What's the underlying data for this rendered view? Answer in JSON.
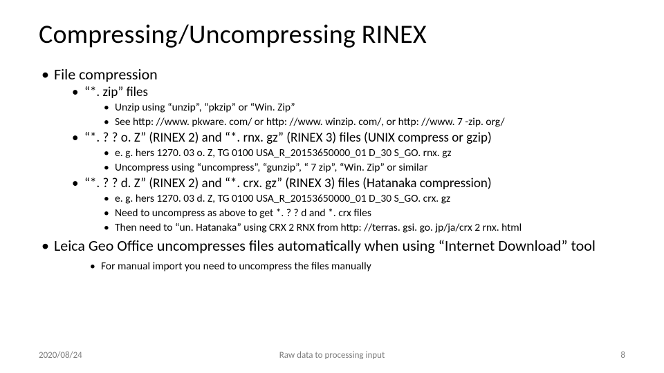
{
  "title": "Compressing/Uncompressing RINEX",
  "bullets": {
    "file_compression": "File compression",
    "zip_files": "“*. zip” files",
    "zip_a": "Unzip using “unzip”, “pkzip” or “Win. Zip”",
    "zip_b": "See http: //www. pkware. com/ or http: //www. winzip. com/, or http: //www. 7 -zip. org/",
    "oz_files": "“*. ? ? o. Z” (RINEX 2) and “*. rnx. gz” (RINEX 3) files (UNIX compress or gzip)",
    "oz_a": "e. g. hers 1270. 03 o. Z, TG 0100 USA_R_20153650000_01 D_30 S_GO. rnx. gz",
    "oz_b": "Uncompress using “uncompress”, “gunzip”, “ 7 zip”, “Win. Zip” or similar",
    "dz_files": "“*. ? ? d. Z” (RINEX 2) and “*. crx. gz” (RINEX 3) files (Hatanaka compression)",
    "dz_a": "e. g. hers 1270. 03 d. Z, TG 0100 USA_R_20153650000_01 D_30 S_GO. crx. gz",
    "dz_b": "Need to uncompress as above to get *. ? ? d and *. crx files",
    "dz_c": "Then need to “un. Hatanaka” using CRX 2 RNX from http: //terras. gsi. go. jp/ja/crx 2 rnx. html",
    "leica": "Leica Geo Office uncompresses files automatically when using “Internet Download” tool",
    "leica_a": "For manual import you need to uncompress the files manually"
  },
  "footer": {
    "date": "2020/08/24",
    "center": "Raw data to processing input",
    "page": "8"
  }
}
